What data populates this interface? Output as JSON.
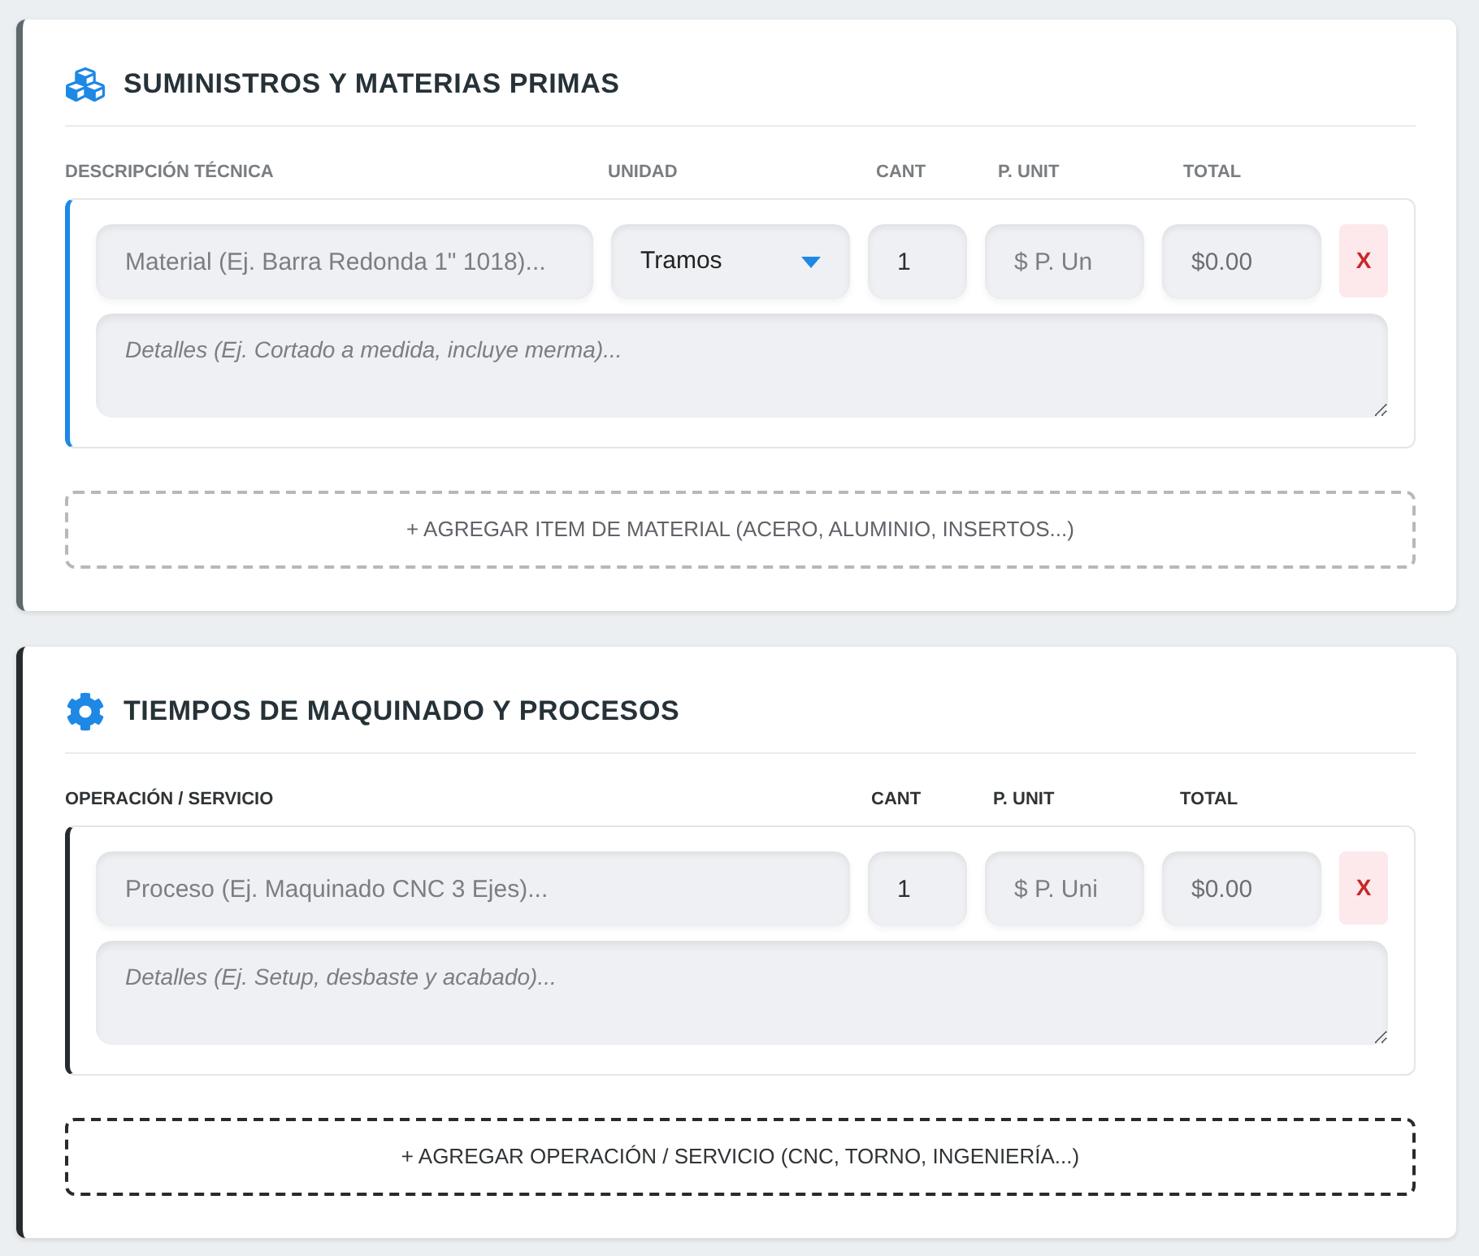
{
  "sections": [
    {
      "kind": "materials",
      "title": "SUMINISTROS Y MATERIAS PRIMAS",
      "columns": [
        "DESCRIPCIÓN TÉCNICA",
        "UNIDAD",
        "CANT",
        "P. UNIT",
        "TOTAL"
      ],
      "items": [
        {
          "description": {
            "placeholder": "Material (Ej. Barra Redonda 1\" 1018)..."
          },
          "unit": {
            "value": "Tramos"
          },
          "quantity": {
            "value": "1"
          },
          "unit_price": {
            "placeholder": "$ P. Un"
          },
          "total": {
            "value": "$0.00"
          },
          "remove_button": "X",
          "details": {
            "placeholder": "Detalles (Ej. Cortado a medida, incluye merma)..."
          }
        }
      ],
      "add_button": "+ AGREGAR ITEM DE MATERIAL (ACERO, ALUMINIO, INSERTOS...)"
    },
    {
      "kind": "processes",
      "title": "TIEMPOS DE MAQUINADO Y PROCESOS",
      "columns": [
        "OPERACIÓN / SERVICIO",
        "CANT",
        "P. UNIT",
        "TOTAL"
      ],
      "items": [
        {
          "description": {
            "placeholder": "Proceso (Ej. Maquinado CNC 3 Ejes)..."
          },
          "quantity": {
            "value": "1"
          },
          "unit_price": {
            "placeholder": "$ P. Uni"
          },
          "total": {
            "value": "$0.00"
          },
          "remove_button": "X",
          "details": {
            "placeholder": "Detalles (Ej. Setup, desbaste y acabado)..."
          }
        }
      ],
      "add_button": "+ AGREGAR OPERACIÓN / SERVICIO (CNC, TORNO, INGENIERÍA...)"
    }
  ]
}
